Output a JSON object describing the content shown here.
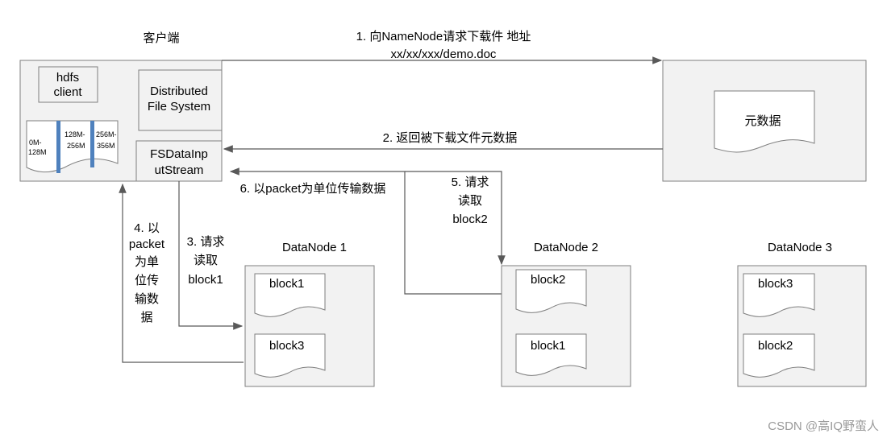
{
  "client": {
    "title": "客户端",
    "hdfs_client": [
      "hdfs",
      "client"
    ],
    "dfs": [
      "Distributed",
      "File System"
    ],
    "fsdis": [
      "FSDataInp",
      "utStream"
    ],
    "file_ranges": [
      [
        "0M-",
        "128M"
      ],
      [
        "128M-",
        "256M"
      ],
      [
        "256M-",
        "356M"
      ]
    ]
  },
  "namenode": {
    "metadata": "元数据"
  },
  "steps": {
    "s1": [
      "1. 向NameNode请求下载件 地址",
      "xx/xx/xxx/demo.doc"
    ],
    "s2": "2. 返回被下载文件元数据",
    "s3": [
      "3. 请求",
      "读取",
      "block1"
    ],
    "s4": [
      "4. 以",
      "packet",
      "为单",
      "位传",
      "输数",
      "据"
    ],
    "s5": [
      "5. 请求",
      "读取",
      "block2"
    ],
    "s6": "6. 以packet为单位传输数据"
  },
  "datanodes": [
    {
      "name": "DataNode 1",
      "blocks": [
        "block1",
        "block3"
      ]
    },
    {
      "name": "DataNode 2",
      "blocks": [
        "block2",
        "block1"
      ]
    },
    {
      "name": "DataNode 3",
      "blocks": [
        "block3",
        "block2"
      ]
    }
  ],
  "colors": {
    "bar": "#4f81bd",
    "box": "#f2f2f2",
    "border": "#7f7f7f"
  },
  "watermark": "CSDN @高IQ野蛮人"
}
